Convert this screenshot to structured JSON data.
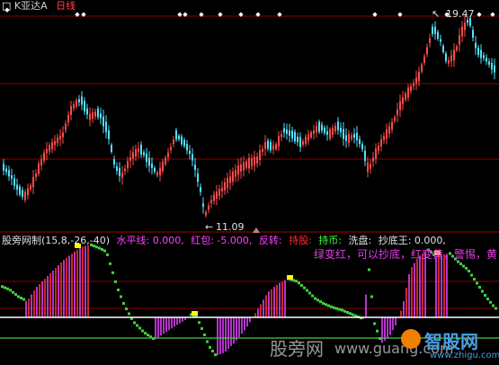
{
  "header": {
    "marker": "□",
    "stock_name": "K亚达A",
    "period": "日线"
  },
  "price_panel": {
    "high_label": "19.47",
    "low_label": "11.09",
    "high_marker": "↖",
    "low_marker": "←"
  },
  "indicator_header": {
    "name": "股旁网制",
    "params": "(15,8,-26,-40)",
    "items": [
      {
        "label": "水平线: ",
        "value": "0.000,",
        "color": "#ff40ff"
      },
      {
        "label": "红包: ",
        "value": "-5.000,",
        "color": "#ff40ff"
      },
      {
        "label": "反转: ",
        "value": "",
        "color": "#ff40ff"
      },
      {
        "label": "持股: ",
        "value": "",
        "color": "#ff3030"
      },
      {
        "label": "持币: ",
        "value": "",
        "color": "#40ff40"
      },
      {
        "label": "洗盘: ",
        "value": "",
        "color": "#e0e0e0"
      },
      {
        "label": "抄底王: ",
        "value": "0.000,",
        "color": "#e0e0e0"
      }
    ],
    "hint": "绿变红，可以抄底，红变黄，警惕，黄"
  },
  "watermark": {
    "left_text": "股旁网",
    "url_text": "www.gu",
    "url_text2": "ang.com",
    "brand": "智股网",
    "brand_url": "www.zhigu.com"
  },
  "colors": {
    "up": "#ff4a4a",
    "down": "#52e0ff",
    "red_bar": "#ff3030",
    "green_bar": "#40d040",
    "magenta_bar": "#e040ff",
    "yellow": "#ffff00",
    "grid": "#8b0000"
  }
}
